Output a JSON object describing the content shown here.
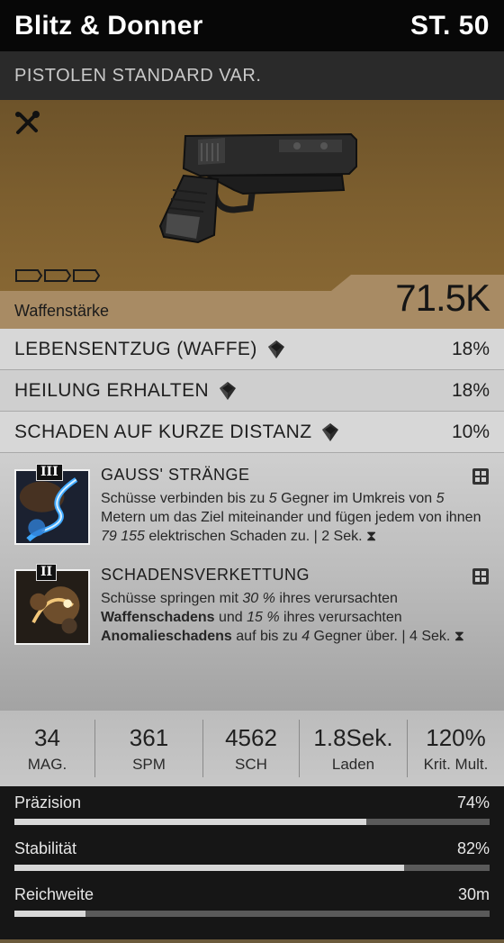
{
  "header": {
    "name": "Blitz & Donner",
    "level": "ST. 50"
  },
  "subtitle": "PISTOLEN STANDARD VAR.",
  "weapon": {
    "power_label": "Waffenstärke",
    "power_value": "71.5K",
    "mod_slots": 3,
    "icons": {
      "mods": "wrench-screwdriver-icon",
      "gun": "pistol-image"
    }
  },
  "attributes": [
    {
      "label": "LEBENSENTZUG (WAFFE)",
      "value": "18%"
    },
    {
      "label": "HEILUNG ERHALTEN",
      "value": "18%"
    },
    {
      "label": "SCHADEN AUF KURZE DISTANZ",
      "value": "10%"
    }
  ],
  "talents": [
    {
      "tier": "III",
      "title": "GAUSS' STRÄNGE",
      "desc": {
        "p1": "Schüsse verbinden bis zu ",
        "n1": "5",
        "p2": " Gegner im Umkreis von ",
        "n2": "5",
        "p3": " Metern um das Ziel miteinander und fügen jedem von ihnen ",
        "n3": "79 155",
        "p4": " elektrischen Schaden zu. | 2 Sek. ⧗"
      }
    },
    {
      "tier": "II",
      "title": "SCHADENSVERKETTUNG",
      "desc": {
        "p1": "Schüsse springen mit ",
        "n1": "30 %",
        "p2": " ihres verursachten ",
        "b1": "Waffenschadens",
        "p3": " und ",
        "n2": "15 %",
        "p4": " ihres verursachten ",
        "b2": "Anomalieschadens",
        "p5": " auf bis zu ",
        "n3": "4",
        "p6": " Gegner über. | 4 Sek. ⧗"
      }
    }
  ],
  "stats": [
    {
      "value": "34",
      "label": "MAG."
    },
    {
      "value": "361",
      "label": "SPM"
    },
    {
      "value": "4562",
      "label": "SCH"
    },
    {
      "value": "1.8Sek.",
      "label": "Laden"
    },
    {
      "value": "120%",
      "label": "Krit. Mult."
    }
  ],
  "bars": [
    {
      "label": "Präzision",
      "value": "74%",
      "fill": 0.74
    },
    {
      "label": "Stabilität",
      "value": "82%",
      "fill": 0.82
    },
    {
      "label": "Reichweite",
      "value": "30m",
      "fill": 0.15
    }
  ],
  "colors": {
    "accent_gold": "#7d5f2f",
    "bar_fill": "#d8d8d8",
    "bar_track": "#5a5a5a"
  }
}
